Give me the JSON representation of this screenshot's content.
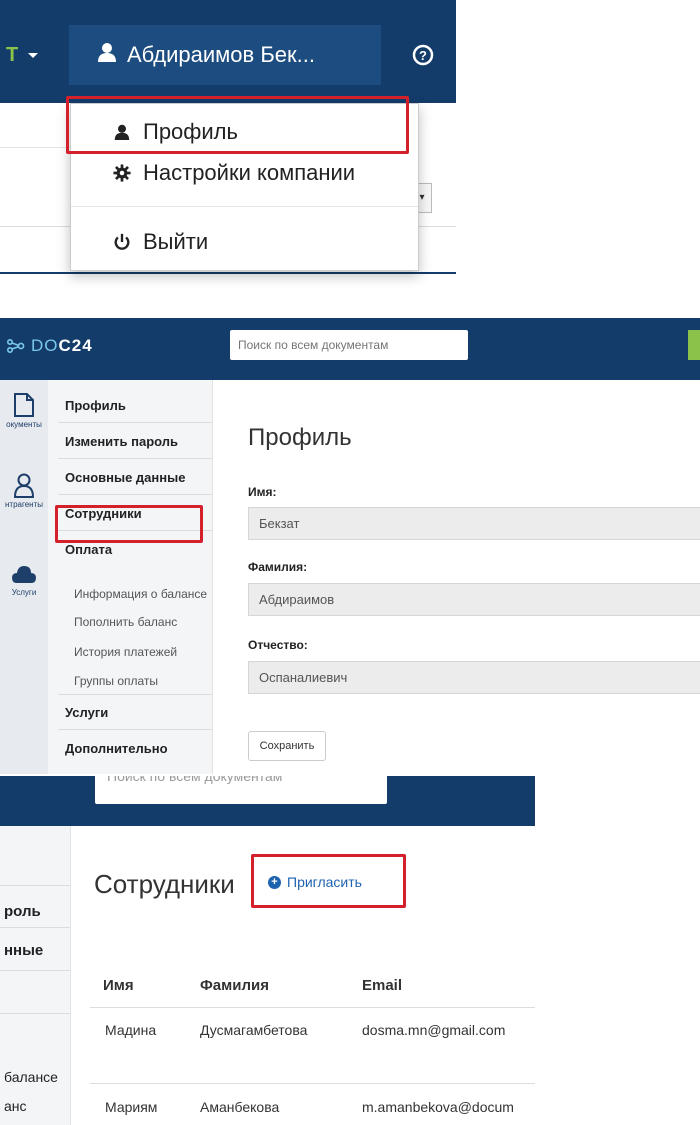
{
  "header": {
    "user_name": "Абдираимов Бек..."
  },
  "user_menu": {
    "items": [
      {
        "label": "Профиль",
        "icon": "user-icon"
      },
      {
        "label": "Настройки компании",
        "icon": "gear-icon"
      },
      {
        "label": "Выйти",
        "icon": "power-icon"
      }
    ]
  },
  "app": {
    "logo_prefix": "DO",
    "logo_suffix": "C24",
    "search_placeholder": "Поиск по всем документам"
  },
  "icon_rail": [
    {
      "label": "окументы",
      "icon": "document-icon"
    },
    {
      "label": "нтрагенты",
      "icon": "contacts-icon"
    },
    {
      "label": "Услуги",
      "icon": "cloud-icon"
    }
  ],
  "sidebar": {
    "items": [
      {
        "label": "Профиль"
      },
      {
        "label": "Изменить пароль"
      },
      {
        "label": "Основные данные"
      },
      {
        "label": "Сотрудники"
      },
      {
        "label": "Оплата"
      }
    ],
    "payment_subitems": [
      {
        "label": "Информация о балансе"
      },
      {
        "label": "Пополнить баланс"
      },
      {
        "label": "История платежей"
      },
      {
        "label": "Группы оплаты"
      }
    ],
    "bottom_items": [
      {
        "label": "Услуги"
      },
      {
        "label": "Дополнительно"
      }
    ]
  },
  "profile": {
    "title": "Профиль",
    "first_name_label": "Имя:",
    "first_name": "Бекзат",
    "last_name_label": "Фамилия:",
    "last_name": "Абдираимов",
    "patronymic_label": "Отчество:",
    "patronymic": "Оспаналиевич",
    "save_label": "Сохранить"
  },
  "employees_panel": {
    "search_partial": "Поиск по всем документам",
    "side_items": [
      {
        "label": "роль"
      },
      {
        "label": "нные"
      },
      {
        "label": "балансе"
      },
      {
        "label": "анс"
      }
    ],
    "title": "Сотрудники",
    "invite_label": "Пригласить",
    "columns": [
      "Имя",
      "Фамилия",
      "Email"
    ],
    "rows": [
      [
        "Мадина",
        "Дусмагамбетова",
        "dosma.mn@gmail.com"
      ],
      [
        "Мариям",
        "Аманбекова",
        "m.amanbekova@docum"
      ]
    ]
  },
  "colors": {
    "navbar": "#133c6b",
    "highlight": "#d4202a",
    "link": "#1e63b0",
    "accent_green": "#8bc34a"
  }
}
